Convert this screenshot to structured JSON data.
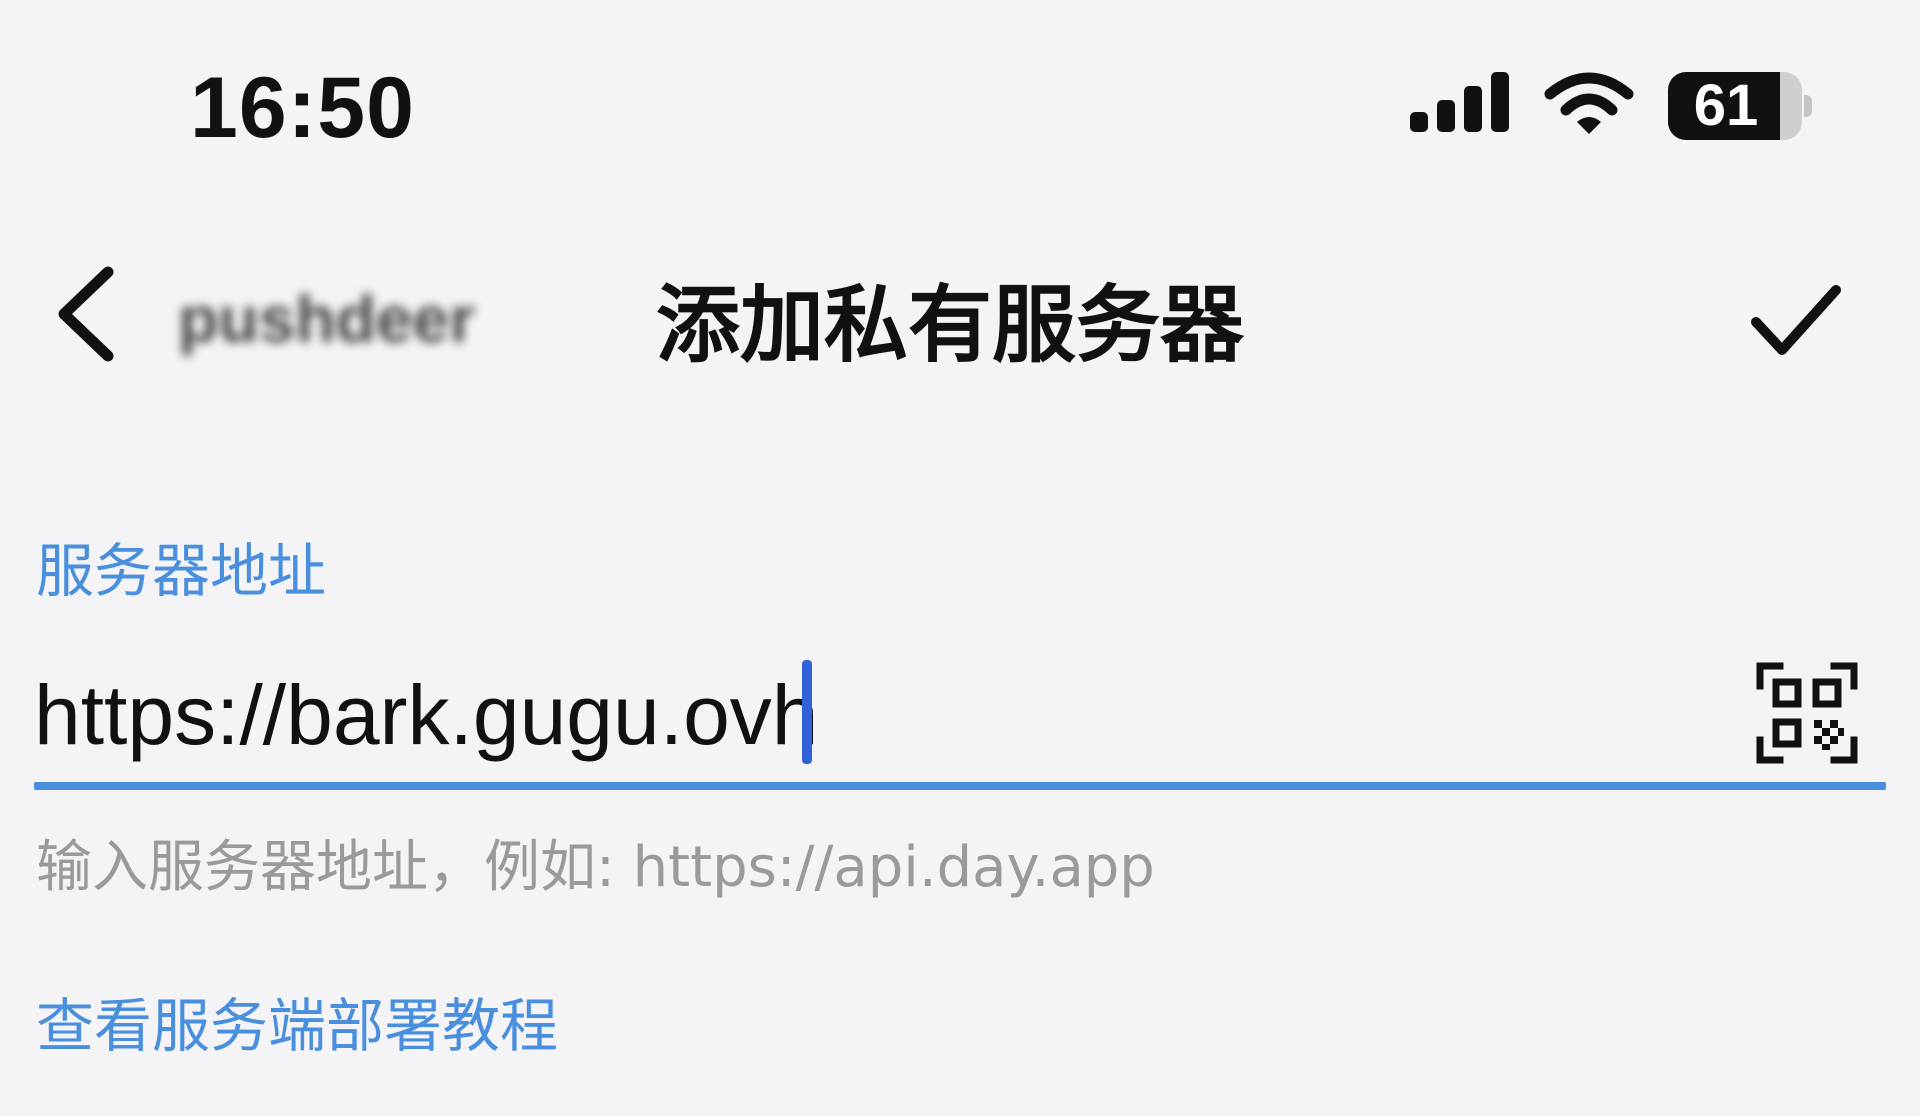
{
  "status_bar": {
    "time": "16:50",
    "battery_level": "61",
    "battery_percent": 61,
    "signal_icon": "signal-bars-icon",
    "wifi_icon": "wifi-icon"
  },
  "nav": {
    "back_icon": "chevron-left-icon",
    "back_label": "pushdeer",
    "title": "添加私有服务器",
    "confirm_icon": "checkmark-icon"
  },
  "form": {
    "server_label": "服务器地址",
    "server_value": "https://bark.gugu.ovh",
    "scan_icon": "qr-scan-icon",
    "helper_text": "输入服务器地址，例如: https://api.day.app",
    "tutorial_link": "查看服务端部署教程"
  },
  "colors": {
    "background": "#f4f4f6",
    "accent": "#4a8fde",
    "caret": "#2f62d8",
    "text_primary": "#111111",
    "text_secondary": "#9a9a9e"
  }
}
